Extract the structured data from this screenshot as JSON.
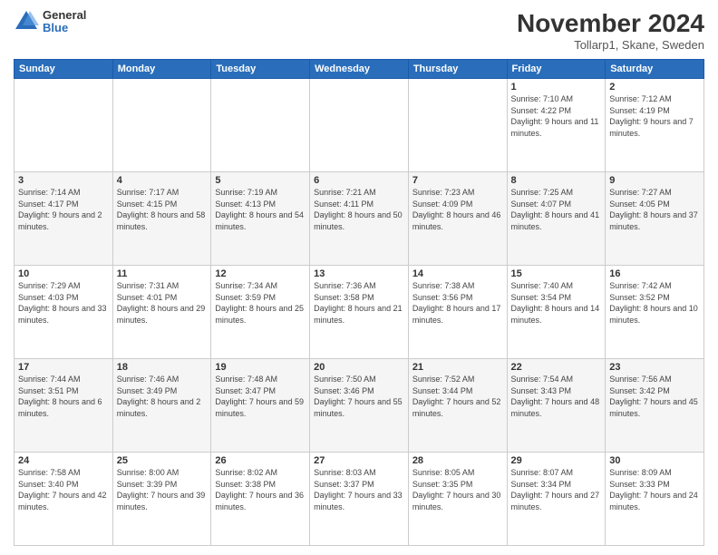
{
  "logo": {
    "general": "General",
    "blue": "Blue"
  },
  "title": "November 2024",
  "location": "Tollarp1, Skane, Sweden",
  "days_header": [
    "Sunday",
    "Monday",
    "Tuesday",
    "Wednesday",
    "Thursday",
    "Friday",
    "Saturday"
  ],
  "weeks": [
    [
      {
        "day": "",
        "sunrise": "",
        "sunset": "",
        "daylight": ""
      },
      {
        "day": "",
        "sunrise": "",
        "sunset": "",
        "daylight": ""
      },
      {
        "day": "",
        "sunrise": "",
        "sunset": "",
        "daylight": ""
      },
      {
        "day": "",
        "sunrise": "",
        "sunset": "",
        "daylight": ""
      },
      {
        "day": "",
        "sunrise": "",
        "sunset": "",
        "daylight": ""
      },
      {
        "day": "1",
        "sunrise": "Sunrise: 7:10 AM",
        "sunset": "Sunset: 4:22 PM",
        "daylight": "Daylight: 9 hours and 11 minutes."
      },
      {
        "day": "2",
        "sunrise": "Sunrise: 7:12 AM",
        "sunset": "Sunset: 4:19 PM",
        "daylight": "Daylight: 9 hours and 7 minutes."
      }
    ],
    [
      {
        "day": "3",
        "sunrise": "Sunrise: 7:14 AM",
        "sunset": "Sunset: 4:17 PM",
        "daylight": "Daylight: 9 hours and 2 minutes."
      },
      {
        "day": "4",
        "sunrise": "Sunrise: 7:17 AM",
        "sunset": "Sunset: 4:15 PM",
        "daylight": "Daylight: 8 hours and 58 minutes."
      },
      {
        "day": "5",
        "sunrise": "Sunrise: 7:19 AM",
        "sunset": "Sunset: 4:13 PM",
        "daylight": "Daylight: 8 hours and 54 minutes."
      },
      {
        "day": "6",
        "sunrise": "Sunrise: 7:21 AM",
        "sunset": "Sunset: 4:11 PM",
        "daylight": "Daylight: 8 hours and 50 minutes."
      },
      {
        "day": "7",
        "sunrise": "Sunrise: 7:23 AM",
        "sunset": "Sunset: 4:09 PM",
        "daylight": "Daylight: 8 hours and 46 minutes."
      },
      {
        "day": "8",
        "sunrise": "Sunrise: 7:25 AM",
        "sunset": "Sunset: 4:07 PM",
        "daylight": "Daylight: 8 hours and 41 minutes."
      },
      {
        "day": "9",
        "sunrise": "Sunrise: 7:27 AM",
        "sunset": "Sunset: 4:05 PM",
        "daylight": "Daylight: 8 hours and 37 minutes."
      }
    ],
    [
      {
        "day": "10",
        "sunrise": "Sunrise: 7:29 AM",
        "sunset": "Sunset: 4:03 PM",
        "daylight": "Daylight: 8 hours and 33 minutes."
      },
      {
        "day": "11",
        "sunrise": "Sunrise: 7:31 AM",
        "sunset": "Sunset: 4:01 PM",
        "daylight": "Daylight: 8 hours and 29 minutes."
      },
      {
        "day": "12",
        "sunrise": "Sunrise: 7:34 AM",
        "sunset": "Sunset: 3:59 PM",
        "daylight": "Daylight: 8 hours and 25 minutes."
      },
      {
        "day": "13",
        "sunrise": "Sunrise: 7:36 AM",
        "sunset": "Sunset: 3:58 PM",
        "daylight": "Daylight: 8 hours and 21 minutes."
      },
      {
        "day": "14",
        "sunrise": "Sunrise: 7:38 AM",
        "sunset": "Sunset: 3:56 PM",
        "daylight": "Daylight: 8 hours and 17 minutes."
      },
      {
        "day": "15",
        "sunrise": "Sunrise: 7:40 AM",
        "sunset": "Sunset: 3:54 PM",
        "daylight": "Daylight: 8 hours and 14 minutes."
      },
      {
        "day": "16",
        "sunrise": "Sunrise: 7:42 AM",
        "sunset": "Sunset: 3:52 PM",
        "daylight": "Daylight: 8 hours and 10 minutes."
      }
    ],
    [
      {
        "day": "17",
        "sunrise": "Sunrise: 7:44 AM",
        "sunset": "Sunset: 3:51 PM",
        "daylight": "Daylight: 8 hours and 6 minutes."
      },
      {
        "day": "18",
        "sunrise": "Sunrise: 7:46 AM",
        "sunset": "Sunset: 3:49 PM",
        "daylight": "Daylight: 8 hours and 2 minutes."
      },
      {
        "day": "19",
        "sunrise": "Sunrise: 7:48 AM",
        "sunset": "Sunset: 3:47 PM",
        "daylight": "Daylight: 7 hours and 59 minutes."
      },
      {
        "day": "20",
        "sunrise": "Sunrise: 7:50 AM",
        "sunset": "Sunset: 3:46 PM",
        "daylight": "Daylight: 7 hours and 55 minutes."
      },
      {
        "day": "21",
        "sunrise": "Sunrise: 7:52 AM",
        "sunset": "Sunset: 3:44 PM",
        "daylight": "Daylight: 7 hours and 52 minutes."
      },
      {
        "day": "22",
        "sunrise": "Sunrise: 7:54 AM",
        "sunset": "Sunset: 3:43 PM",
        "daylight": "Daylight: 7 hours and 48 minutes."
      },
      {
        "day": "23",
        "sunrise": "Sunrise: 7:56 AM",
        "sunset": "Sunset: 3:42 PM",
        "daylight": "Daylight: 7 hours and 45 minutes."
      }
    ],
    [
      {
        "day": "24",
        "sunrise": "Sunrise: 7:58 AM",
        "sunset": "Sunset: 3:40 PM",
        "daylight": "Daylight: 7 hours and 42 minutes."
      },
      {
        "day": "25",
        "sunrise": "Sunrise: 8:00 AM",
        "sunset": "Sunset: 3:39 PM",
        "daylight": "Daylight: 7 hours and 39 minutes."
      },
      {
        "day": "26",
        "sunrise": "Sunrise: 8:02 AM",
        "sunset": "Sunset: 3:38 PM",
        "daylight": "Daylight: 7 hours and 36 minutes."
      },
      {
        "day": "27",
        "sunrise": "Sunrise: 8:03 AM",
        "sunset": "Sunset: 3:37 PM",
        "daylight": "Daylight: 7 hours and 33 minutes."
      },
      {
        "day": "28",
        "sunrise": "Sunrise: 8:05 AM",
        "sunset": "Sunset: 3:35 PM",
        "daylight": "Daylight: 7 hours and 30 minutes."
      },
      {
        "day": "29",
        "sunrise": "Sunrise: 8:07 AM",
        "sunset": "Sunset: 3:34 PM",
        "daylight": "Daylight: 7 hours and 27 minutes."
      },
      {
        "day": "30",
        "sunrise": "Sunrise: 8:09 AM",
        "sunset": "Sunset: 3:33 PM",
        "daylight": "Daylight: 7 hours and 24 minutes."
      }
    ]
  ]
}
